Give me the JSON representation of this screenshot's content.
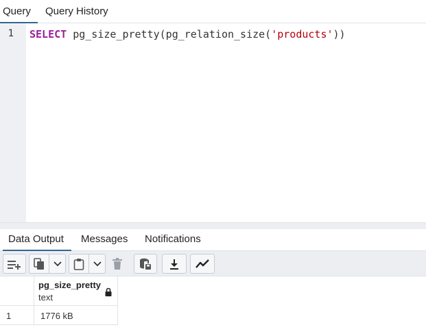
{
  "top_tabs": {
    "query": "Query",
    "query_history": "Query History"
  },
  "editor": {
    "line_number": "1",
    "code": {
      "keyword": "SELECT",
      "pre_string": " pg_size_pretty(pg_relation_size(",
      "string": "'products'",
      "post_string": "))"
    }
  },
  "bottom_tabs": {
    "data_output": "Data Output",
    "messages": "Messages",
    "notifications": "Notifications"
  },
  "toolbar": {
    "icons": [
      "add-row-icon",
      "copy-icon",
      "chevron-down-icon",
      "paste-icon",
      "chevron-down-icon",
      "trash-icon",
      "save-data-icon",
      "download-icon",
      "graph-icon"
    ]
  },
  "grid": {
    "columns": [
      {
        "name": "pg_size_pretty",
        "type": "text",
        "locked": true
      }
    ],
    "rows": [
      {
        "row_number": "1",
        "values": [
          "1776 kB"
        ]
      }
    ]
  },
  "colors": {
    "active_tab_underline": "#326690",
    "gutter_bg": "#eff0f4",
    "keyword": "#9a1f9a",
    "string": "#b3000c",
    "toolbar_bg": "#eceef2"
  }
}
